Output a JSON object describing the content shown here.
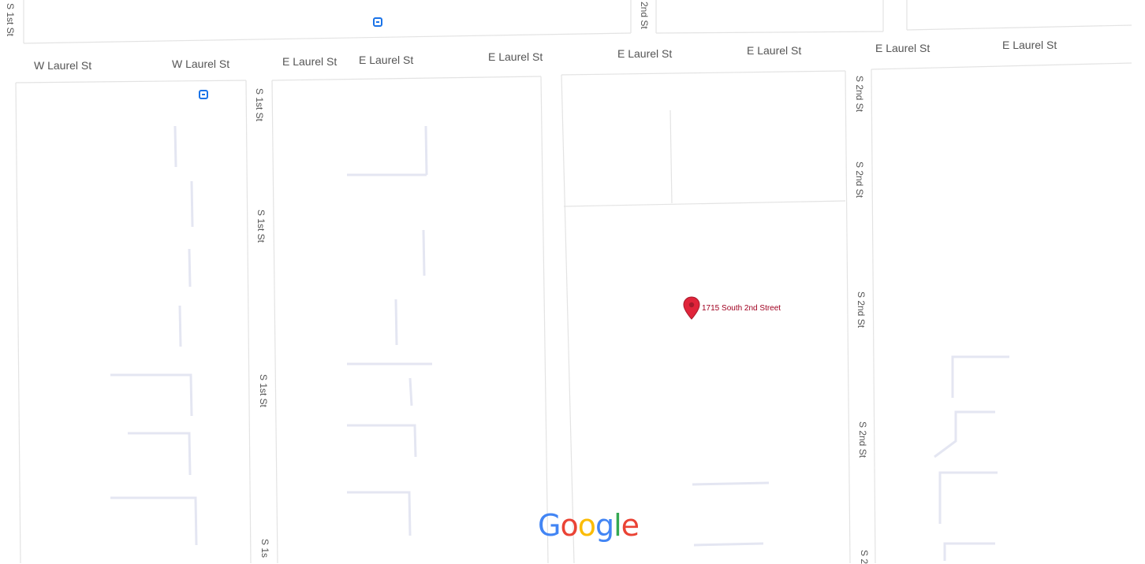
{
  "streets": {
    "laurel": [
      "W Laurel St",
      "W Laurel St",
      "E Laurel St",
      "E Laurel St",
      "E Laurel St",
      "E Laurel St",
      "E Laurel St",
      "E Laurel St",
      "E Laurel St"
    ],
    "first": [
      "S 1st St",
      "S 1st St",
      "S 1st St",
      "S 1st St",
      "S 1s"
    ],
    "second": [
      "2nd St",
      "S 2nd St",
      "S 2nd St",
      "S 2nd St",
      "S 2nd St",
      "S 2"
    ]
  },
  "marker": {
    "label": "1715 South 2nd Street",
    "color": "#e0243a"
  },
  "logo": {
    "letters": [
      "G",
      "o",
      "o",
      "g",
      "l",
      "e"
    ],
    "colors": [
      "#4285F4",
      "#EA4335",
      "#FBBC05",
      "#4285F4",
      "#34A853",
      "#EA4335"
    ]
  },
  "icons": {
    "transit": "transit-station-icon",
    "pin": "map-pin-icon"
  }
}
